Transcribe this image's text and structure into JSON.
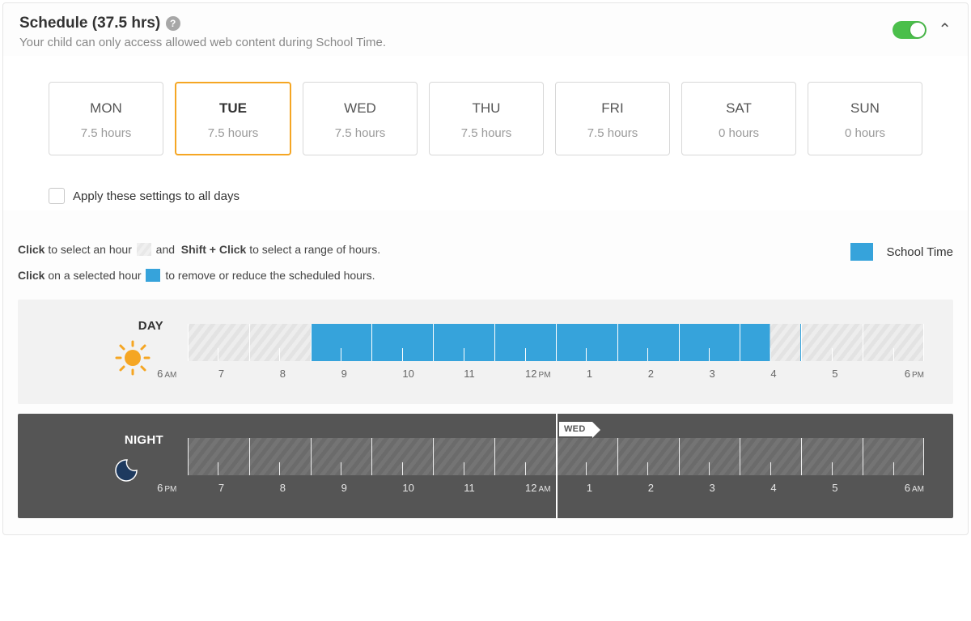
{
  "header": {
    "title": "Schedule (37.5 hrs)",
    "subtitle": "Your child can only access allowed web content during School Time.",
    "toggle_on": true
  },
  "days": [
    {
      "label": "MON",
      "hours": "7.5 hours",
      "selected": false
    },
    {
      "label": "TUE",
      "hours": "7.5 hours",
      "selected": true
    },
    {
      "label": "WED",
      "hours": "7.5 hours",
      "selected": false
    },
    {
      "label": "THU",
      "hours": "7.5 hours",
      "selected": false
    },
    {
      "label": "FRI",
      "hours": "7.5 hours",
      "selected": false
    },
    {
      "label": "SAT",
      "hours": "0 hours",
      "selected": false
    },
    {
      "label": "SUN",
      "hours": "0 hours",
      "selected": false
    }
  ],
  "apply_all_label": "Apply these settings to all days",
  "instructions": {
    "line1_a": "Click",
    "line1_b": "to select an hour",
    "line1_c": "and",
    "line1_d": "Shift + Click",
    "line1_e": "to select a range of hours.",
    "line2_a": "Click",
    "line2_b": "on a selected hour",
    "line2_c": "to remove or reduce the scheduled hours."
  },
  "legend_label": "School Time",
  "day_timeline": {
    "label": "DAY",
    "hour_labels": [
      "6 AM",
      "7",
      "8",
      "9",
      "10",
      "11",
      "12 PM",
      "1",
      "2",
      "3",
      "4",
      "5",
      "6 PM"
    ],
    "selected_slots": [
      2,
      3,
      4,
      5,
      6,
      7,
      8
    ],
    "half_slot": 9
  },
  "night_timeline": {
    "label": "NIGHT",
    "hour_labels": [
      "6 PM",
      "7",
      "8",
      "9",
      "10",
      "11",
      "12 AM",
      "1",
      "2",
      "3",
      "4",
      "5",
      "6 AM"
    ],
    "next_day_tag": "WED",
    "midnight_index": 6,
    "selected_slots": [],
    "half_slot": null
  }
}
